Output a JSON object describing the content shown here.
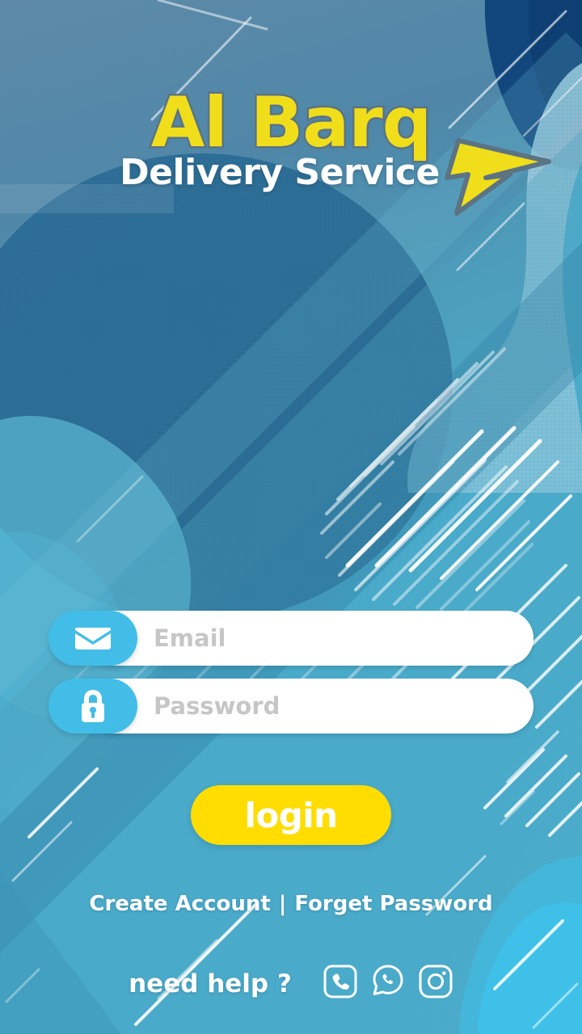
{
  "app": {
    "brand_name": "Al Barq",
    "tagline": "Delivery Service",
    "logo_bolt_icon": "lightning-bolt-icon"
  },
  "colors": {
    "brand_yellow": "#F0DE1B",
    "button_yellow": "#FFDD00",
    "accent_cyan": "#42BDE8",
    "background_teal": "#4BA6C4",
    "background_deep_blue": "#2E6F97",
    "background_navy": "#12477E",
    "text_white": "#FFFFFF",
    "placeholder_gray": "#C6C6C6",
    "logo_outline": "#5C7383"
  },
  "form": {
    "email": {
      "icon": "envelope-icon",
      "placeholder": "Email",
      "value": ""
    },
    "password": {
      "icon": "lock-icon",
      "placeholder": "Password",
      "value": ""
    },
    "submit_label": "login"
  },
  "links": {
    "create_account": "Create Account",
    "separator": "|",
    "forget_password": "Forget Password"
  },
  "help": {
    "label": "need help ?",
    "channels": [
      {
        "name": "phone-icon",
        "label": "Phone"
      },
      {
        "name": "whatsapp-icon",
        "label": "WhatsApp"
      },
      {
        "name": "instagram-icon",
        "label": "Instagram"
      }
    ]
  }
}
